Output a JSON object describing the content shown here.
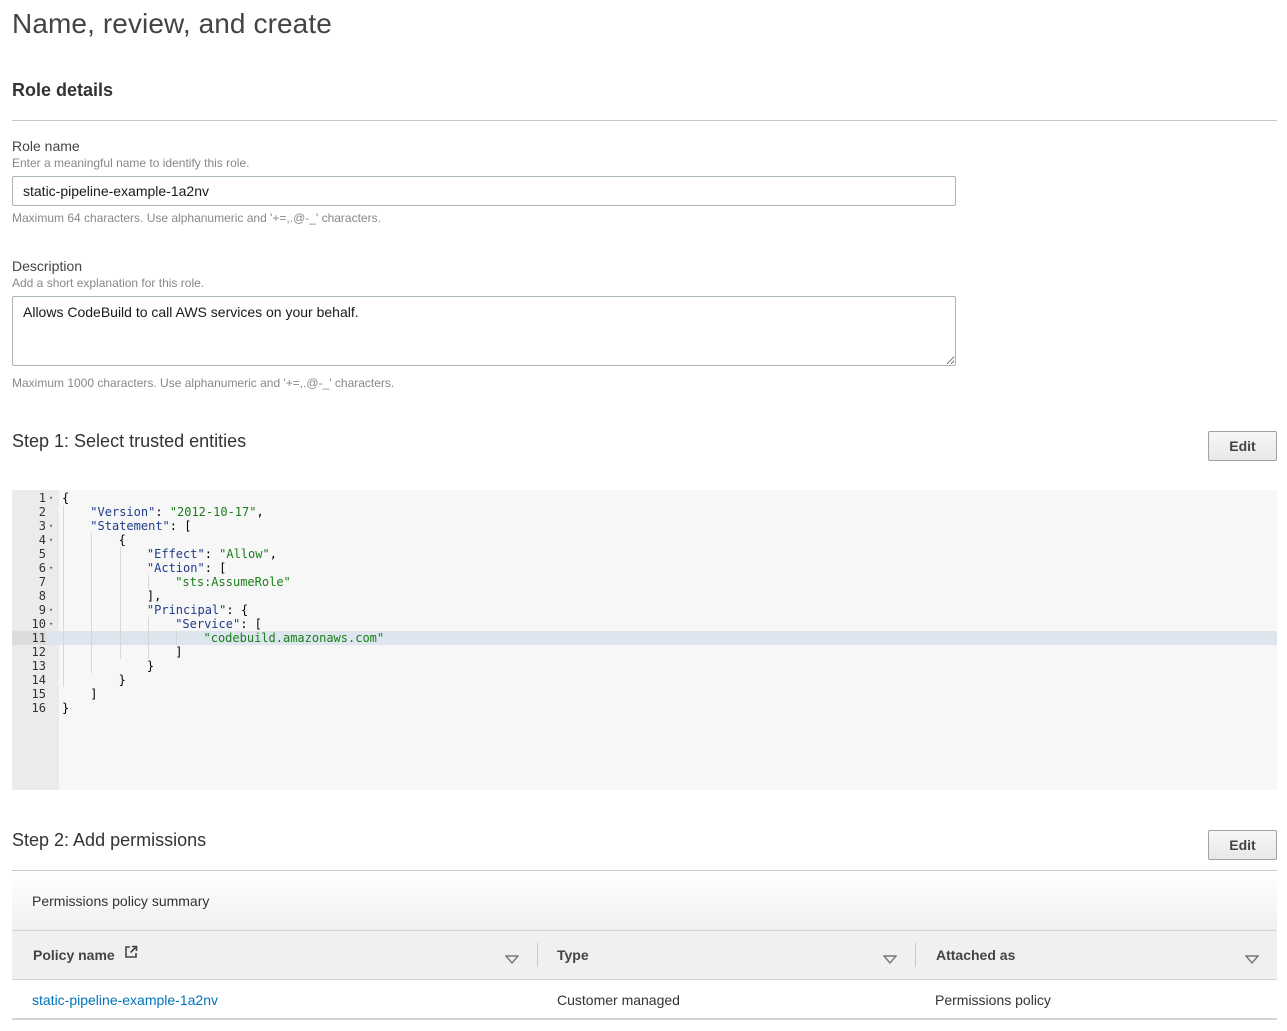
{
  "page_title": "Name, review, and create",
  "role_details": {
    "heading": "Role details",
    "role_name": {
      "label": "Role name",
      "hint": "Enter a meaningful name to identify this role.",
      "value": "static-pipeline-example-1a2nv",
      "constraint": "Maximum 64 characters. Use alphanumeric and '+=,.@-_' characters."
    },
    "description": {
      "label": "Description",
      "hint": "Add a short explanation for this role.",
      "value": "Allows CodeBuild to call AWS services on your behalf.",
      "constraint": "Maximum 1000 characters. Use alphanumeric and '+=,.@-_' characters."
    }
  },
  "step1": {
    "title": "Step 1: Select trusted entities",
    "edit_label": "Edit",
    "active_line": 11,
    "code_lines": [
      {
        "num": "1",
        "fold": true,
        "indent": 0,
        "tokens": [
          [
            "punct",
            "{"
          ]
        ]
      },
      {
        "num": "2",
        "fold": false,
        "indent": 1,
        "tokens": [
          [
            "key",
            "\"Version\""
          ],
          [
            "punct",
            ": "
          ],
          [
            "str",
            "\"2012-10-17\""
          ],
          [
            "punct",
            ","
          ]
        ]
      },
      {
        "num": "3",
        "fold": true,
        "indent": 1,
        "tokens": [
          [
            "key",
            "\"Statement\""
          ],
          [
            "punct",
            ": ["
          ]
        ]
      },
      {
        "num": "4",
        "fold": true,
        "indent": 2,
        "tokens": [
          [
            "punct",
            "{"
          ]
        ]
      },
      {
        "num": "5",
        "fold": false,
        "indent": 3,
        "tokens": [
          [
            "key",
            "\"Effect\""
          ],
          [
            "punct",
            ": "
          ],
          [
            "str",
            "\"Allow\""
          ],
          [
            "punct",
            ","
          ]
        ]
      },
      {
        "num": "6",
        "fold": true,
        "indent": 3,
        "tokens": [
          [
            "key",
            "\"Action\""
          ],
          [
            "punct",
            ": ["
          ]
        ]
      },
      {
        "num": "7",
        "fold": false,
        "indent": 4,
        "tokens": [
          [
            "str",
            "\"sts:AssumeRole\""
          ]
        ]
      },
      {
        "num": "8",
        "fold": false,
        "indent": 3,
        "tokens": [
          [
            "punct",
            "],"
          ]
        ]
      },
      {
        "num": "9",
        "fold": true,
        "indent": 3,
        "tokens": [
          [
            "key",
            "\"Principal\""
          ],
          [
            "punct",
            ": {"
          ]
        ]
      },
      {
        "num": "10",
        "fold": true,
        "indent": 4,
        "tokens": [
          [
            "key",
            "\"Service\""
          ],
          [
            "punct",
            ": ["
          ]
        ]
      },
      {
        "num": "11",
        "fold": false,
        "indent": 5,
        "tokens": [
          [
            "str",
            "\"codebuild.amazonaws.com\""
          ]
        ]
      },
      {
        "num": "12",
        "fold": false,
        "indent": 4,
        "tokens": [
          [
            "punct",
            "]"
          ]
        ]
      },
      {
        "num": "13",
        "fold": false,
        "indent": 3,
        "tokens": [
          [
            "punct",
            "}"
          ]
        ]
      },
      {
        "num": "14",
        "fold": false,
        "indent": 2,
        "tokens": [
          [
            "punct",
            "}"
          ]
        ]
      },
      {
        "num": "15",
        "fold": false,
        "indent": 1,
        "tokens": [
          [
            "punct",
            "]"
          ]
        ]
      },
      {
        "num": "16",
        "fold": false,
        "indent": 0,
        "tokens": [
          [
            "punct",
            "}"
          ]
        ]
      }
    ]
  },
  "step2": {
    "title": "Step 2: Add permissions",
    "edit_label": "Edit",
    "summary_label": "Permissions policy summary",
    "columns": [
      "Policy name",
      "Type",
      "Attached as"
    ],
    "rows": [
      {
        "policy_name": "static-pipeline-example-1a2nv",
        "type": "Customer managed",
        "attached_as": "Permissions policy"
      }
    ]
  },
  "icons": {
    "fold": "fold-arrow-icon",
    "external": "external-link-icon",
    "sort": "sort-caret-icon"
  },
  "colors": {
    "link": "#0073bb",
    "json_key": "#1f3b8c",
    "json_string": "#1a7d1a",
    "active_line": "#dde6ee"
  }
}
